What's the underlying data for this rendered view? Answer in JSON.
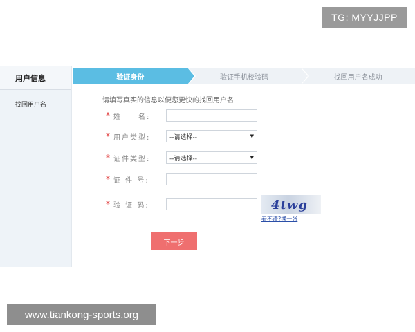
{
  "badge": {
    "text": "TG: MYYJJPP"
  },
  "sidebar": {
    "title": "用户信息",
    "items": [
      {
        "label": "找回用户名"
      }
    ]
  },
  "steps": [
    {
      "label": "验证身份",
      "active": true
    },
    {
      "label": "验证手机校验码",
      "active": false
    },
    {
      "label": "找回用户名成功",
      "active": false
    }
  ],
  "form": {
    "instruction": "请填写真实的信息以便您更快的找回用户名",
    "required_mark": "*",
    "name_label": "姓　　名:",
    "name_value": "",
    "user_type_label": "用户类型:",
    "user_type_value": "--请选择--",
    "id_type_label": "证件类型:",
    "id_type_value": "--请选择--",
    "id_number_label": "证 件 号:",
    "id_number_value": "",
    "captcha_label": "验 证 码:",
    "captcha_value": "",
    "captcha_text": "4twg",
    "captcha_refresh": "看不清?换一张",
    "next_label": "下一步"
  },
  "watermark": {
    "text": "www.tiankong-sports.org"
  },
  "colors": {
    "step_active": "#5bbde3",
    "step_inactive": "#eef2f6",
    "required": "#e03b3b",
    "next_button": "#ef6f6f",
    "link": "#2b4fa8"
  }
}
